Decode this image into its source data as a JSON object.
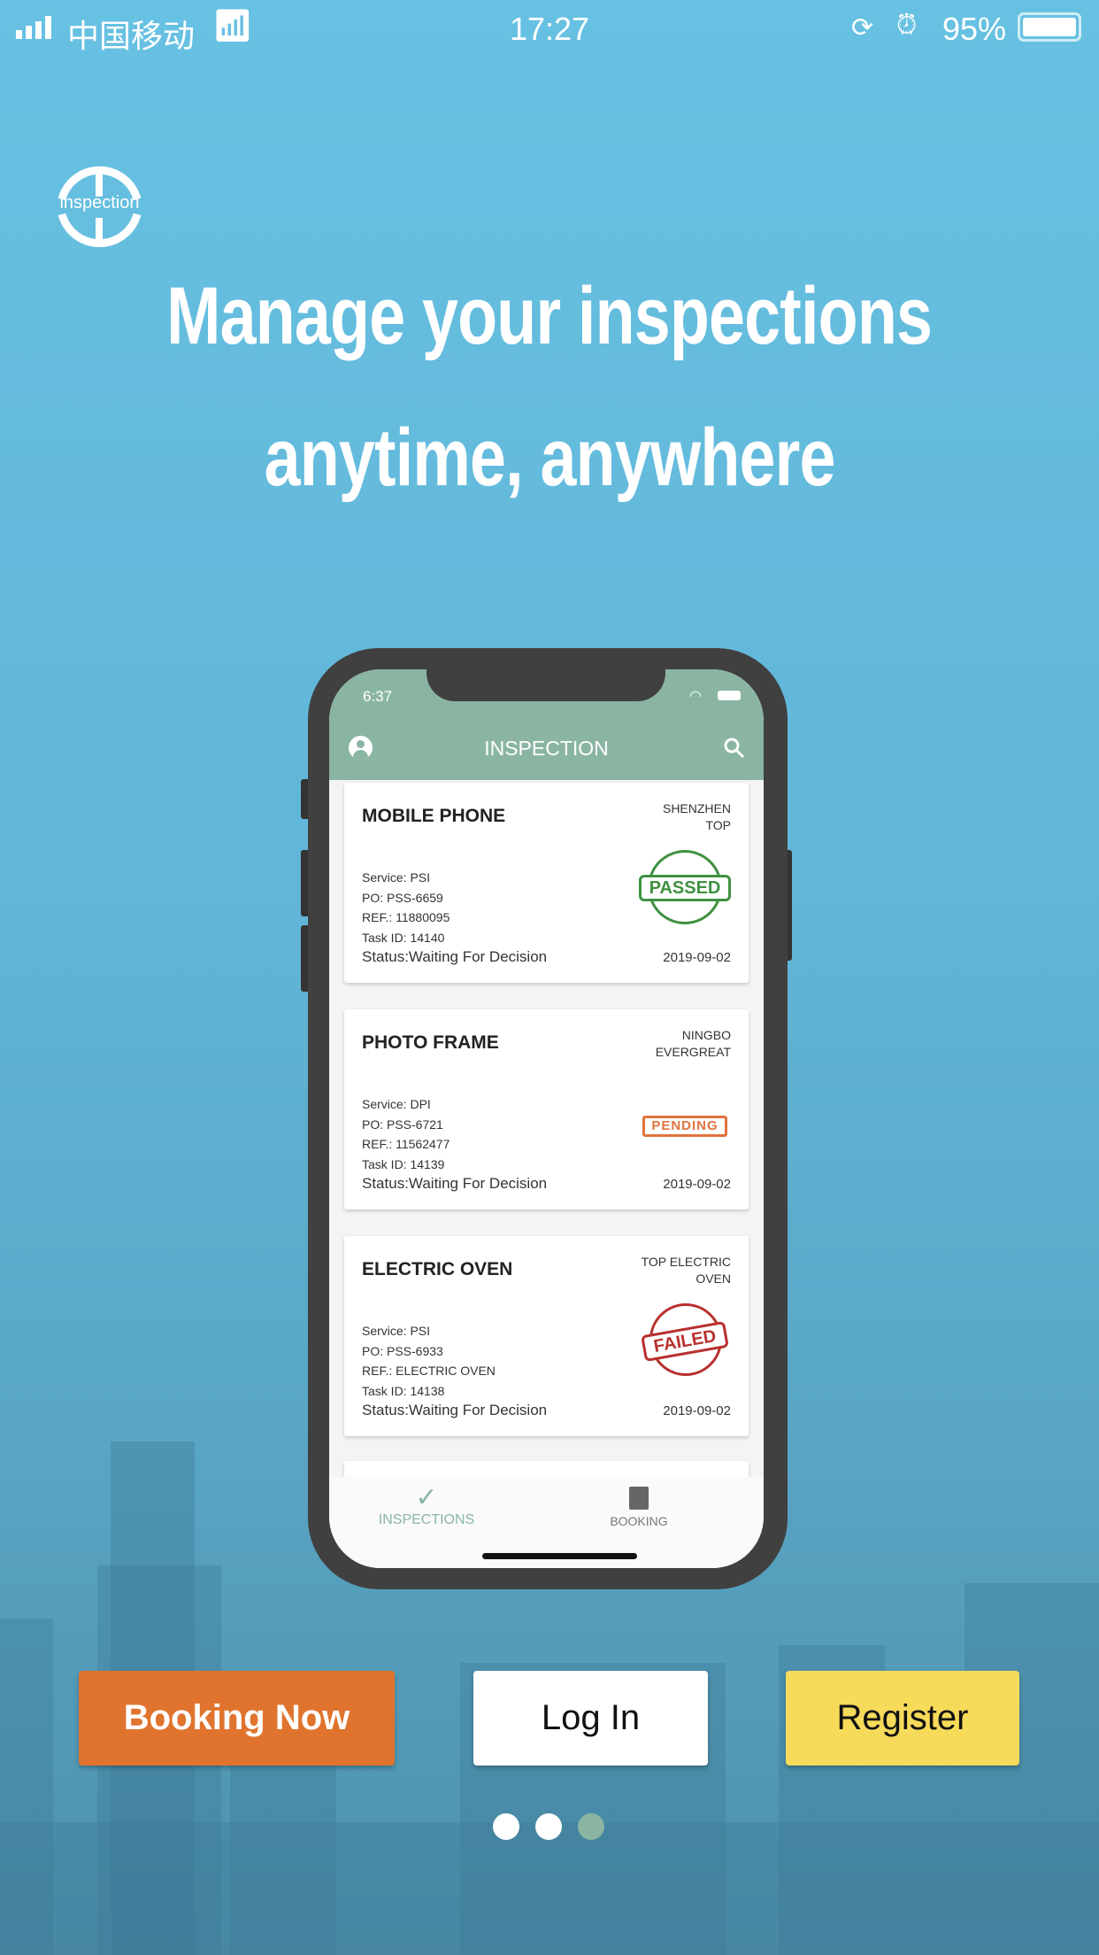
{
  "status_bar": {
    "carrier": "中国移动",
    "time": "17:27",
    "battery": "95%"
  },
  "logo": {
    "text": "inspection"
  },
  "headline": {
    "line1": "Manage your inspections",
    "line2": "anytime, anywhere"
  },
  "mockup": {
    "status_time": "6:37",
    "app_title": "INSPECTION",
    "header_color": "#8ab5a3",
    "cards": [
      {
        "title": "MOBILE PHONE",
        "factory_line1": "SHENZHEN",
        "factory_line2": "TOP",
        "service": "Service: PSI",
        "po": "PO: PSS-6659",
        "ref": "REF.: 11880095",
        "task": "Task ID: 14140",
        "status": "Status:Waiting For Decision",
        "date": "2019-09-02",
        "stamp": "PASSED"
      },
      {
        "title": "PHOTO FRAME",
        "factory_line1": "NINGBO",
        "factory_line2": "EVERGREAT",
        "service": "Service: DPI",
        "po": "PO: PSS-6721",
        "ref": "REF.: 11562477",
        "task": "Task ID: 14139",
        "status": "Status:Waiting For Decision",
        "date": "2019-09-02",
        "stamp": "PENDING"
      },
      {
        "title": "ELECTRIC OVEN",
        "factory_line1": "TOP ELECTRIC",
        "factory_line2": "OVEN",
        "service": "Service: PSI",
        "po": "PO: PSS-6933",
        "ref": "REF.: ELECTRIC OVEN",
        "task": "Task ID: 14138",
        "status": "Status:Waiting For Decision",
        "date": "2019-09-02",
        "stamp": "FAILED"
      }
    ],
    "tabs": [
      {
        "label": "INSPECTIONS",
        "icon": "check-icon",
        "active": true
      },
      {
        "label": "BOOKING",
        "icon": "document-icon",
        "active": false
      }
    ]
  },
  "buttons": {
    "booking": "Booking Now",
    "login": "Log In",
    "register": "Register"
  },
  "colors": {
    "booking": "#e0742e",
    "login": "#ffffff",
    "register": "#f6da5a",
    "active_dot": "#8ab5a3"
  },
  "pager": {
    "pages": 3,
    "active": 3
  }
}
